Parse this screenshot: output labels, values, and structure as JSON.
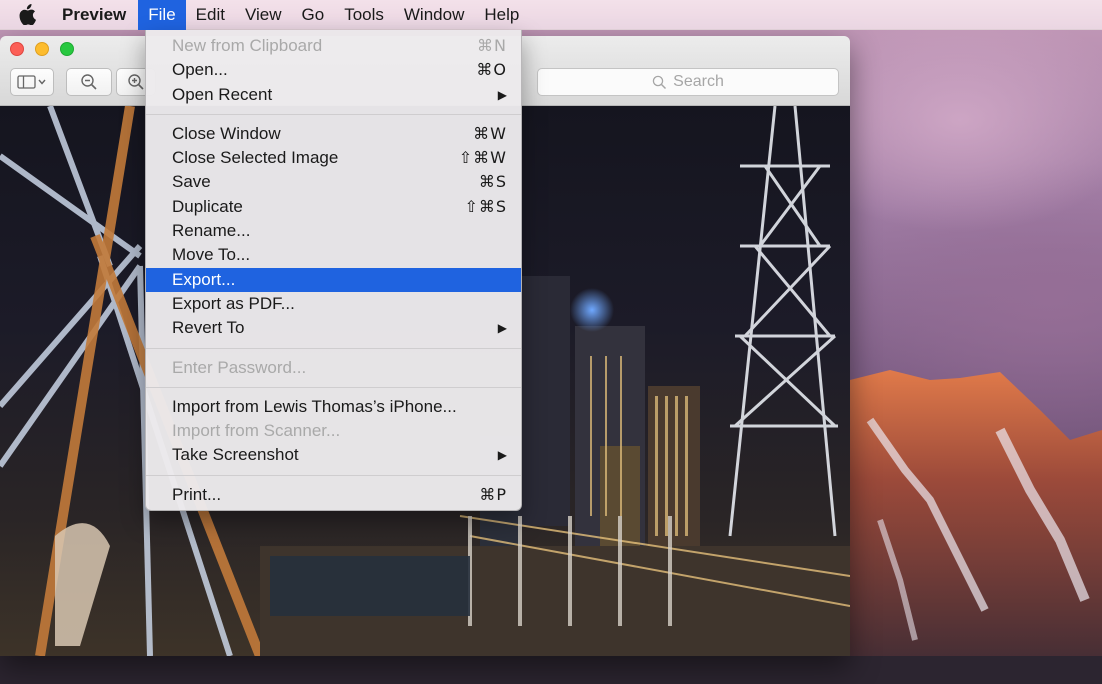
{
  "menubar": {
    "apple_icon": "apple-icon",
    "app_name": "Preview",
    "items": [
      {
        "label": "File",
        "active": true
      },
      {
        "label": "Edit"
      },
      {
        "label": "View"
      },
      {
        "label": "Go"
      },
      {
        "label": "Tools"
      },
      {
        "label": "Window"
      },
      {
        "label": "Help"
      }
    ]
  },
  "window": {
    "toolbar": {
      "sidebar_icon": "sidebar-toggle-icon",
      "zoom_out_icon": "zoom-out-icon",
      "zoom_in_icon": "zoom-in-icon",
      "search_placeholder": "Search"
    }
  },
  "file_menu": {
    "items": [
      {
        "label": "New from Clipboard",
        "shortcut": "⌘N",
        "disabled": true
      },
      {
        "label": "Open...",
        "shortcut": "⌘O"
      },
      {
        "label": "Open Recent",
        "submenu": true
      },
      {
        "separator": true
      },
      {
        "label": "Close Window",
        "shortcut": "⌘W"
      },
      {
        "label": "Close Selected Image",
        "shortcut": "⇧⌘W"
      },
      {
        "label": "Save",
        "shortcut": "⌘S"
      },
      {
        "label": "Duplicate",
        "shortcut": "⇧⌘S"
      },
      {
        "label": "Rename..."
      },
      {
        "label": "Move To..."
      },
      {
        "label": "Export...",
        "highlighted": true
      },
      {
        "label": "Export as PDF..."
      },
      {
        "label": "Revert To",
        "submenu": true
      },
      {
        "separator": true
      },
      {
        "label": "Enter Password...",
        "disabled": true
      },
      {
        "separator": true
      },
      {
        "label": "Import from Lewis Thomas’s iPhone..."
      },
      {
        "label": "Import from Scanner...",
        "disabled": true
      },
      {
        "label": "Take Screenshot",
        "submenu": true
      },
      {
        "separator": true
      },
      {
        "label": "Print...",
        "shortcut": "⌘P"
      }
    ],
    "submenu_arrow": "▶"
  },
  "colors": {
    "highlight": "#1f63e0",
    "menu_bg": "#eceaec",
    "disabled_text": "#a9a9a9"
  }
}
